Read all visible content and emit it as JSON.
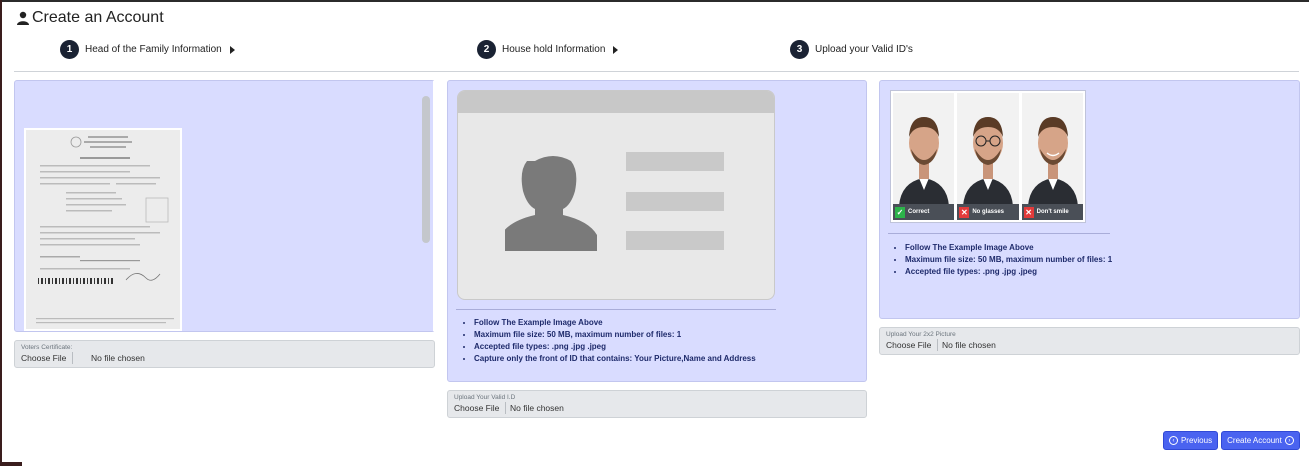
{
  "page": {
    "title": "Create an Account"
  },
  "steps": [
    {
      "number": "1",
      "label": "Head of the Family Information"
    },
    {
      "number": "2",
      "label": "House hold Information"
    },
    {
      "number": "3",
      "label": "Upload your Valid ID's"
    }
  ],
  "uploads": {
    "voters": {
      "label": "Voters Certificate:",
      "button": "Choose File",
      "status": "No file chosen"
    },
    "valid_id": {
      "label": "Upload Your Valid I.D",
      "button": "Choose File",
      "status": "No file chosen"
    },
    "picture": {
      "label": "Upload Your 2x2 Picture",
      "button": "Choose File",
      "status": "No file chosen"
    }
  },
  "id_instructions": [
    "Follow The Example Image Above",
    "Maximum file size: 50 MB, maximum number of files: 1",
    "Accepted file types: .png .jpg .jpeg",
    "Capture only the front of ID that contains: Your Picture,Name and Address"
  ],
  "photo_instructions": [
    "Follow The Example Image Above",
    "Maximum file size: 50 MB, maximum number of files: 1",
    "Accepted file types: .png .jpg .jpeg"
  ],
  "photo_examples": [
    {
      "caption": "Correct",
      "status_color": "#2db34a",
      "glasses": false
    },
    {
      "caption": "No glasses",
      "status_color": "#e23b3b",
      "glasses": true
    },
    {
      "caption": "Don't smile",
      "status_color": "#e23b3b",
      "glasses": false
    }
  ],
  "buttons": {
    "previous": "Previous",
    "create": "Create Account"
  },
  "colors": {
    "accent": "#4a63f0",
    "panel_bg": "#d9dcff",
    "step_badge": "#1a2233"
  }
}
